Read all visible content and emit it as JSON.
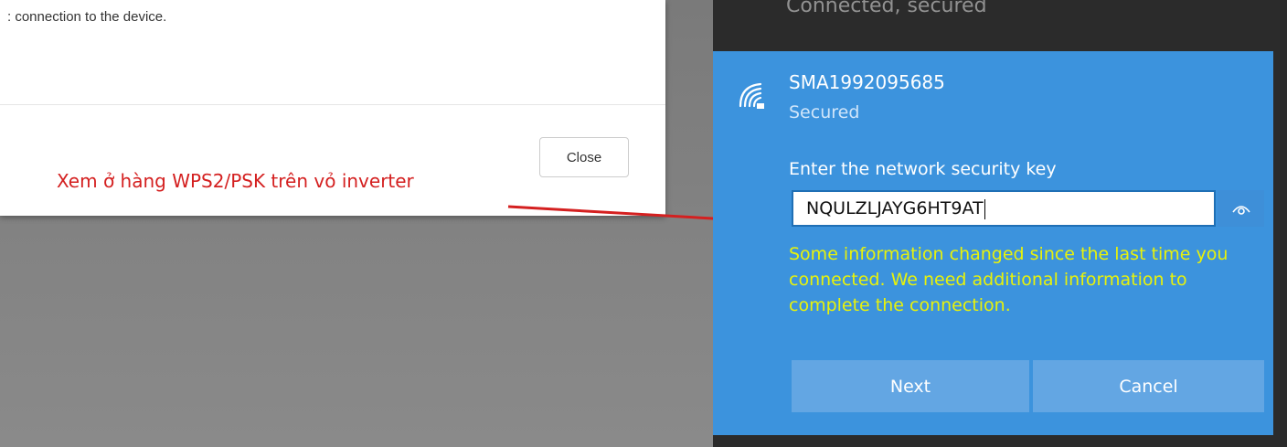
{
  "dialog": {
    "message": ": connection to the device.",
    "close_label": "Close"
  },
  "annotation": {
    "text": "Xem ở hàng WPS2/PSK trên vỏ inverter",
    "color": "#d42020"
  },
  "network_panel": {
    "connected_text": "Connected, secured",
    "ssid": "SMA1992095685",
    "status": "Secured",
    "key_label": "Enter the network security key",
    "key_value": "NQULZLJAYG6HT9AT",
    "warning": "Some information changed since the last time you connected. We need additional information to complete the connection.",
    "next_label": "Next",
    "cancel_label": "Cancel",
    "accent_color": "#3c93dd",
    "warning_color": "#e8f20a",
    "icons": [
      "wifi-secured-icon",
      "reveal-password-icon"
    ]
  }
}
